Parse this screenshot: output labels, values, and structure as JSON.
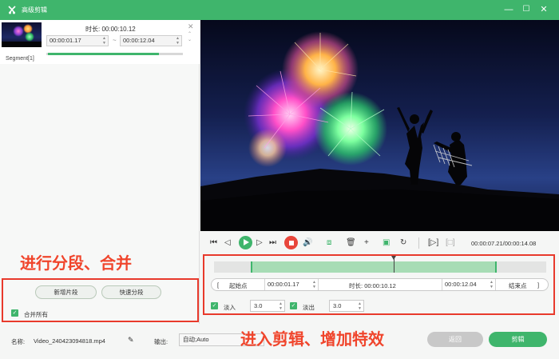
{
  "window": {
    "title": "高级剪辑",
    "controls": {
      "minimize": "—",
      "maximize": "☐",
      "close": "✕"
    }
  },
  "segment": {
    "label": "Segment[1]",
    "duration_label": "时长:",
    "duration": "00:00:10.12",
    "start": "00:00:01.17",
    "end": "00:00:12.04",
    "separator": "~",
    "progress": 0.82
  },
  "annotations": {
    "left": "进行分段、合并",
    "right": "进入剪辑、增加特效"
  },
  "left_actions": {
    "new_segment": "新增片段",
    "quick_split": "快速分段",
    "merge_all": "合并所有",
    "merge_all_checked": true
  },
  "player": {
    "timecode": "00:00:07.21/00:00:14.08",
    "playhead_fraction": 0.54,
    "selection": {
      "start_fraction": 0.11,
      "end_fraction": 0.85
    }
  },
  "range": {
    "start_button": "起始点",
    "start_value": "00:00:01.17",
    "duration_label": "时长:",
    "duration_value": "00:00:10.12",
    "end_value": "00:00:12.04",
    "end_button": "结束点"
  },
  "fade": {
    "fade_in_label": "淡入",
    "fade_in_value": "3.0",
    "fade_in_checked": true,
    "fade_out_label": "淡出",
    "fade_out_value": "3.0",
    "fade_out_checked": true
  },
  "bottom": {
    "name_label": "名称:",
    "name_value": "Video_240423094818.mp4",
    "output_label": "输出:",
    "output_value": "自动;Auto",
    "return_button": "返回",
    "edit_button": "剪辑"
  },
  "colors": {
    "accent": "#3fb56c",
    "annotation": "#f0452c",
    "stop": "#e8463b"
  }
}
